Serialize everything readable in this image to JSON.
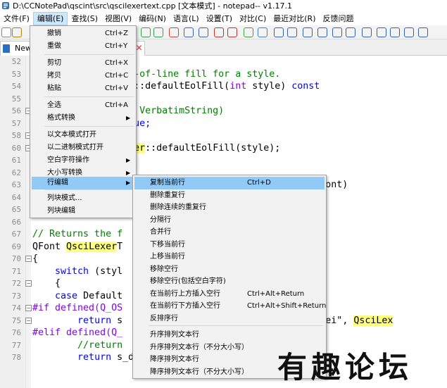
{
  "window": {
    "title": "D:\\CCNotePad\\qscint\\src\\qscilexertext.cpp [文本模式] - notepad-- v1.17.1"
  },
  "menubar": [
    "文件(F)",
    "编辑(E)",
    "查找(S)",
    "视图(V)",
    "编码(N)",
    "语言(L)",
    "设置(T)",
    "对比(C)",
    "最近对比(R)",
    "反馈问题"
  ],
  "tab": {
    "label": "New"
  },
  "editor": {
    "lines": [
      {
        "n": "52",
        "parts": [
          {
            "t": "    "
          }
        ]
      },
      {
        "n": "53",
        "parts": [
          {
            "t": "                 ",
            "c": ""
          },
          {
            "t": "d-of-line fill for a style.",
            "c": "cm"
          }
        ]
      },
      {
        "n": "54",
        "parts": [
          {
            "t": "                 t::defaultEolFill("
          },
          {
            "t": "int",
            "c": "ty"
          },
          {
            "t": " style) "
          },
          {
            "t": "const",
            "c": "kw"
          }
        ]
      },
      {
        "n": "55",
        "parts": [
          {
            "t": ""
          }
        ]
      },
      {
        "n": "56",
        "parts": [
          {
            "t": "                 "
          },
          {
            "t": "= VerbatimString)",
            "c": "cm"
          }
        ]
      },
      {
        "n": "57",
        "parts": [
          {
            "t": "                 "
          },
          {
            "t": "rue;",
            "c": "kw"
          }
        ]
      },
      {
        "n": "58",
        "parts": [
          {
            "t": ""
          }
        ]
      },
      {
        "n": "60",
        "parts": [
          {
            "t": "                 "
          },
          {
            "t": "xer",
            "c": "hl"
          },
          {
            "t": "::defaultEolFill(style);"
          }
        ]
      },
      {
        "n": "61",
        "parts": [
          {
            "t": ""
          }
        ]
      },
      {
        "n": "62",
        "parts": [
          {
            "t": ""
          }
        ]
      },
      {
        "n": "63",
        "parts": [
          {
            "t": "                                            Font & font)"
          }
        ]
      },
      {
        "n": "64",
        "parts": [
          {
            "t": "    s_defaultTxt"
          }
        ]
      },
      {
        "n": "65",
        "parts": [
          {
            "t": "}"
          }
        ]
      },
      {
        "n": "66",
        "parts": [
          {
            "t": ""
          }
        ]
      },
      {
        "n": "67",
        "parts": [
          {
            "t": "// Returns the f",
            "c": "cm"
          }
        ]
      },
      {
        "n": "69",
        "parts": [
          {
            "t": "QFont "
          },
          {
            "t": "QsciLexer",
            "c": "hl"
          },
          {
            "t": "T                                 t"
          }
        ]
      },
      {
        "n": "70",
        "parts": [
          {
            "t": "{"
          }
        ]
      },
      {
        "n": "71",
        "parts": [
          {
            "t": "    "
          },
          {
            "t": "switch",
            "c": "kw"
          },
          {
            "t": " (styl"
          }
        ]
      },
      {
        "n": "72",
        "parts": [
          {
            "t": "    {"
          }
        ]
      },
      {
        "n": "73",
        "parts": [
          {
            "t": "    "
          },
          {
            "t": "case",
            "c": "kw"
          },
          {
            "t": " Default"
          }
        ]
      },
      {
        "n": "74",
        "parts": [
          {
            "t": "#if defined(Q_OS",
            "c": "ty"
          }
        ]
      },
      {
        "n": "75",
        "parts": [
          {
            "t": "        "
          },
          {
            "t": "return",
            "c": "kw"
          },
          {
            "t": " s                             oft YaHei\", "
          },
          {
            "t": "QsciLex",
            "c": "hl"
          }
        ]
      },
      {
        "n": "76",
        "parts": [
          {
            "t": "#elif defined(Q_",
            "c": "ty"
          }
        ]
      },
      {
        "n": "77",
        "parts": [
          {
            "t": "        "
          },
          {
            "t": "//return",
            "c": "cm"
          }
        ]
      },
      {
        "n": "78",
        "parts": [
          {
            "t": "        "
          },
          {
            "t": "return",
            "c": "kw"
          },
          {
            "t": " s_defaultTxtFont;"
          }
        ]
      }
    ]
  },
  "edit_menu": [
    {
      "label": "撤销",
      "shortcut": "Ctrl+Z"
    },
    {
      "label": "重做",
      "shortcut": "Ctrl+Y"
    },
    {
      "label": "剪切",
      "shortcut": "Ctrl+X"
    },
    {
      "label": "拷贝",
      "shortcut": "Ctrl+C"
    },
    {
      "label": "粘贴",
      "shortcut": "Ctrl+V"
    },
    {
      "label": "全选",
      "shortcut": "Ctrl+A"
    },
    {
      "label": "格式转换",
      "shortcut": ""
    },
    {
      "label": "以文本模式打开",
      "shortcut": ""
    },
    {
      "label": "以二进制模式打开",
      "shortcut": ""
    },
    {
      "label": "空白字符操作",
      "shortcut": ""
    },
    {
      "label": "大小写转换",
      "shortcut": ""
    },
    {
      "label": "行编辑",
      "shortcut": ""
    },
    {
      "label": "列块模式...",
      "shortcut": ""
    },
    {
      "label": "列块编辑",
      "shortcut": ""
    }
  ],
  "line_menu": [
    {
      "label": "复制当前行",
      "shortcut": "Ctrl+D"
    },
    {
      "label": "删除重复行",
      "shortcut": ""
    },
    {
      "label": "删除连续的重复行",
      "shortcut": ""
    },
    {
      "label": "分隔行",
      "shortcut": ""
    },
    {
      "label": "合并行",
      "shortcut": ""
    },
    {
      "label": "下移当前行",
      "shortcut": ""
    },
    {
      "label": "上移当前行",
      "shortcut": ""
    },
    {
      "label": "移除空行",
      "shortcut": ""
    },
    {
      "label": "移除空行(包括空白字符)",
      "shortcut": ""
    },
    {
      "label": "在当前行上方插入空行",
      "shortcut": "Ctrl+Alt+Return"
    },
    {
      "label": "在当前行下方插入空行",
      "shortcut": "Ctrl+Alt+Shift+Return"
    },
    {
      "label": "反排序行",
      "shortcut": ""
    },
    {
      "label": "升序排列文本行",
      "shortcut": ""
    },
    {
      "label": "升序排列文本行（不分大小写）",
      "shortcut": ""
    },
    {
      "label": "降序排列文本行",
      "shortcut": ""
    },
    {
      "label": "降序排列文本行（不分大小写）",
      "shortcut": ""
    }
  ],
  "watermark": "有趣论坛"
}
